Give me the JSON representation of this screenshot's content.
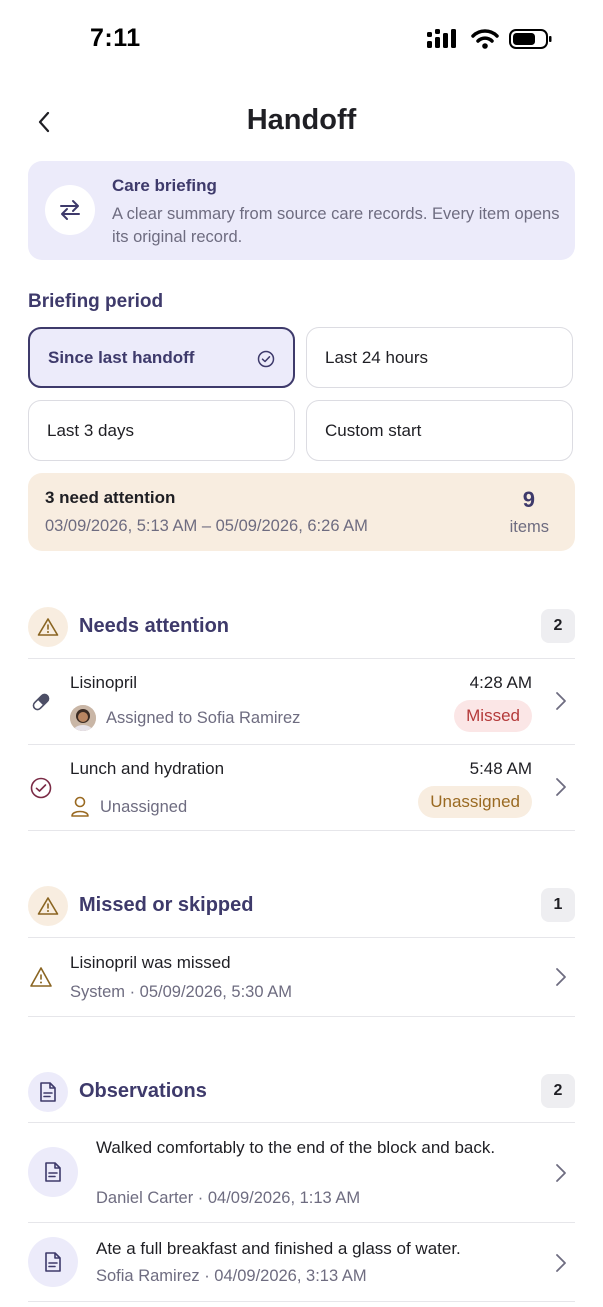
{
  "status_bar": {
    "time": "7:11"
  },
  "nav": {
    "title": "Handoff"
  },
  "care_briefing": {
    "title": "Care briefing",
    "text": "A clear summary from source care records. Every item opens its original record."
  },
  "briefing_period": {
    "label": "Briefing period",
    "options": [
      "Since last handoff",
      "Last 24 hours",
      "Last 3 days",
      "Custom start"
    ],
    "selected": "Since last handoff"
  },
  "summary": {
    "title": "3 need attention",
    "range": "03/09/2026, 5:13 AM – 05/09/2026, 6:26 AM",
    "count": "9",
    "unit": "items"
  },
  "needs_attention": {
    "title": "Needs attention",
    "count": "2",
    "items": [
      {
        "title": "Lisinopril",
        "subtitle": "Assigned to Sofia Ramirez",
        "time": "4:28 AM",
        "status": "Missed"
      },
      {
        "title": "Lunch and hydration",
        "subtitle": "Unassigned",
        "time": "5:48 AM",
        "status": "Unassigned"
      }
    ]
  },
  "missed_skipped": {
    "title": "Missed or skipped",
    "count": "1",
    "items": [
      {
        "title": "Lisinopril was missed",
        "subtitle": "System · 05/09/2026, 5:30 AM"
      }
    ]
  },
  "observations": {
    "title": "Observations",
    "count": "2",
    "items": [
      {
        "title": "Walked comfortably to the end of the block and back.",
        "subtitle": "Daniel Carter · 04/09/2026, 1:13 AM"
      },
      {
        "title": "Ate a full breakfast and finished a glass of water.",
        "subtitle": "Sofia Ramirez · 04/09/2026, 3:13 AM"
      }
    ]
  },
  "colors": {
    "accent": "#3e3a6b",
    "accent_bg": "#ecebfa",
    "warning_bg": "#f8ede0",
    "missed": "#b43a3a",
    "unassigned": "#9a6a22"
  }
}
